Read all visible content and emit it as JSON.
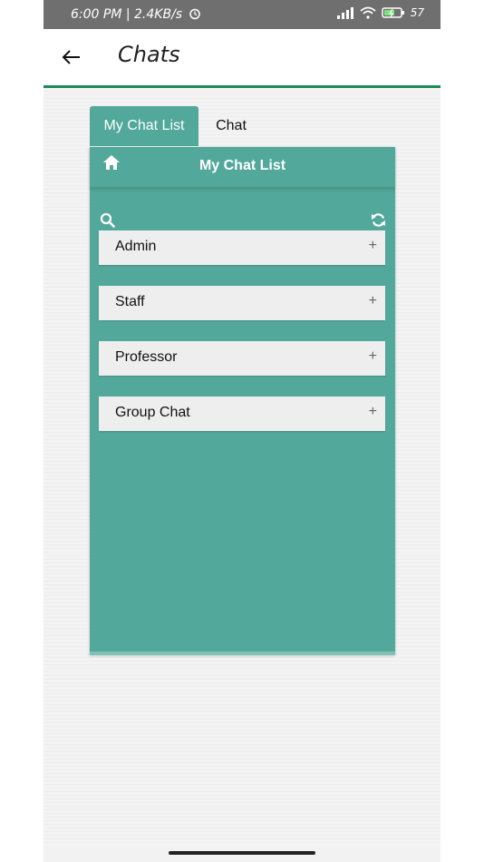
{
  "status_bar": {
    "left_text": "6:00 PM | 2.4KB/s",
    "battery_text": "57"
  },
  "app_bar": {
    "title": "Chats",
    "back_icon": "arrow-left-icon"
  },
  "tabs": [
    {
      "label": "My Chat List",
      "active": true
    },
    {
      "label": "Chat",
      "active": false
    }
  ],
  "panel": {
    "title": "My Chat List",
    "home_icon": "home-icon",
    "search_icon": "search-icon",
    "refresh_icon": "refresh-icon"
  },
  "chat_groups": [
    {
      "label": "Admin",
      "expand": "+"
    },
    {
      "label": "Staff",
      "expand": "+"
    },
    {
      "label": "Professor",
      "expand": "+"
    },
    {
      "label": "Group Chat",
      "expand": "+"
    }
  ],
  "colors": {
    "accent": "#52a89a",
    "app_bar_border": "#1f8a55",
    "status_bar": "#6f6f6f"
  }
}
